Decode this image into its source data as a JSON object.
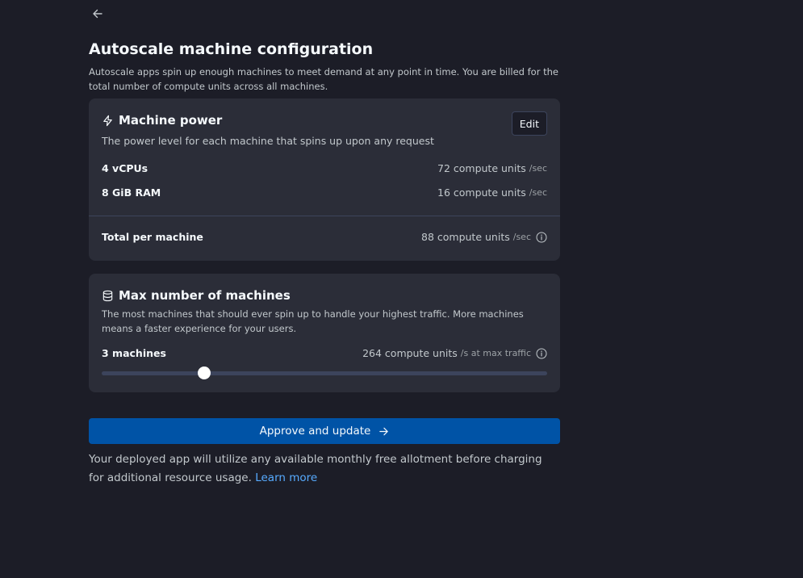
{
  "title": "Autoscale machine configuration",
  "subtitle": "Autoscale apps spin up enough machines to meet demand at any point in time. You are billed for the total number of compute units across all machines.",
  "machine_power": {
    "icon": "lightning-icon",
    "title": "Machine power",
    "edit_label": "Edit",
    "description": "The power level for each machine that spins up upon any request",
    "rows": [
      {
        "label": "4 vCPUs",
        "value": "72 compute units",
        "unit": "/sec"
      },
      {
        "label": "8 GiB RAM",
        "value": "16 compute units",
        "unit": "/sec"
      }
    ],
    "total": {
      "label": "Total per machine",
      "value": "88 compute units",
      "unit": "/sec"
    }
  },
  "max_machines": {
    "icon": "database-icon",
    "title": "Max number of machines",
    "description": "The most machines that should ever spin up to handle your highest traffic. More machines means a faster experience for your users.",
    "count_label": "3 machines",
    "compute_value": "264 compute units",
    "compute_unit": "/s",
    "compute_suffix": " at max traffic",
    "slider_fraction": 0.23
  },
  "approve_label": "Approve and update",
  "footer": {
    "text": "Your deployed app will utilize any available monthly free allotment before charging for additional resource usage. ",
    "link": "Learn more"
  },
  "colors": {
    "background": "#1c1d27",
    "card": "#2b2d38",
    "primary_button": "#0053a6",
    "link": "#57abff"
  }
}
